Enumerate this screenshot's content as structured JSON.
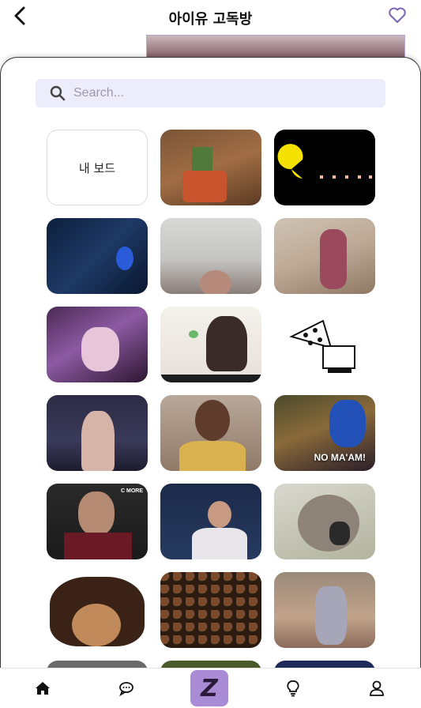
{
  "header": {
    "title": "아이유 고독방"
  },
  "search": {
    "placeholder": "Search..."
  },
  "grid": {
    "board_label": "내 보드",
    "captions": {
      "no_maam": "NO MA'AM!",
      "cmore": "C MORE"
    }
  },
  "nav": {
    "center_letter": "Z"
  },
  "colors": {
    "accent": "#a98bd6",
    "search_bg": "#ececfb",
    "heart": "#7b62b8"
  },
  "icons": [
    "chevron-left-icon",
    "heart-icon",
    "search-icon",
    "home-icon",
    "chat-icon",
    "lightbulb-icon",
    "user-icon"
  ]
}
